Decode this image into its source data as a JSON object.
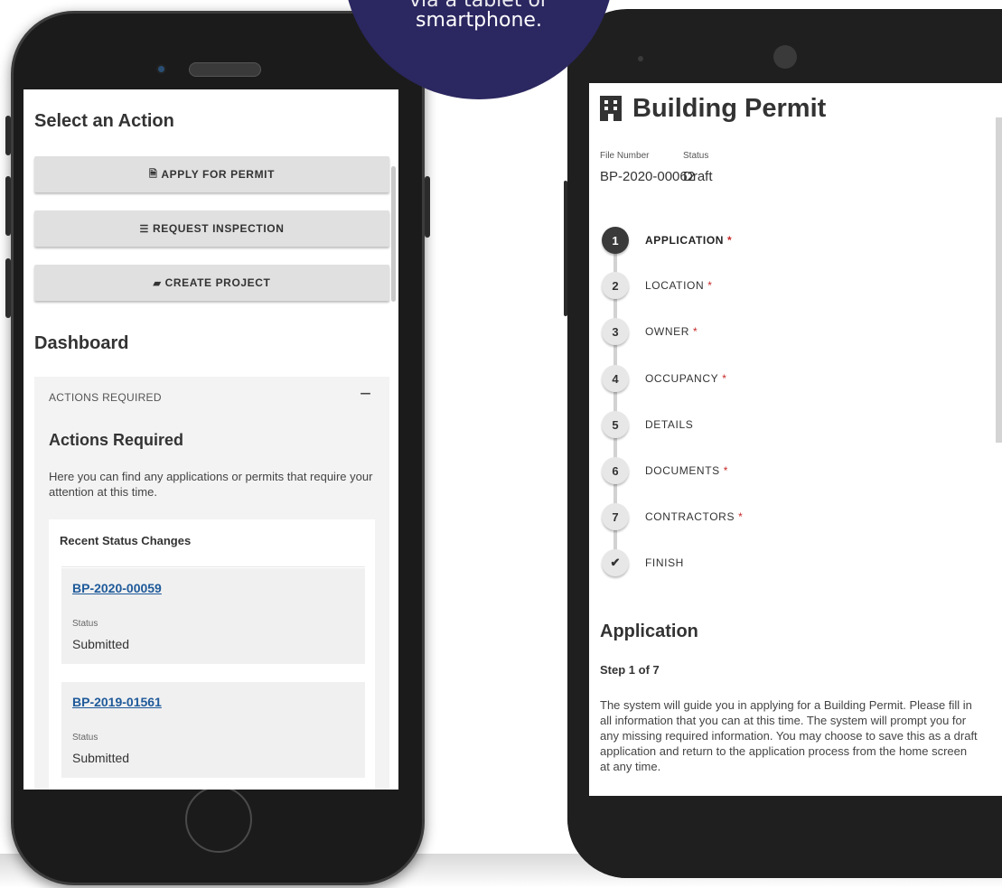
{
  "banner": {
    "line1": "via a tablet or",
    "line2": "smartphone."
  },
  "left_phone": {
    "select_action_title": "Select an Action",
    "actions": [
      {
        "icon": "document-icon",
        "glyph": "🗎",
        "label": "APPLY FOR PERMIT"
      },
      {
        "icon": "checklist-icon",
        "glyph": "☰",
        "label": "REQUEST INSPECTION"
      },
      {
        "icon": "folder-icon",
        "glyph": "▰",
        "label": "CREATE PROJECT"
      }
    ],
    "dashboard_title": "Dashboard",
    "panel": {
      "header": "ACTIONS REQUIRED",
      "collapse_glyph": "−",
      "title": "Actions Required",
      "description": "Here you can find any applications or permits that require your attention at this time.",
      "card": {
        "title": "Recent Status Changes",
        "items": [
          {
            "link": "BP-2020-00059",
            "status_label": "Status",
            "status_value": "Submitted"
          },
          {
            "link": "BP-2019-01561",
            "status_label": "Status",
            "status_value": "Submitted"
          }
        ]
      }
    }
  },
  "right_phone": {
    "title": "Building Permit",
    "file_number_label": "File Number",
    "file_number_value": "BP-2020-00062",
    "status_label": "Status",
    "status_value": "Draft",
    "steps": [
      {
        "num": "1",
        "label": "APPLICATION",
        "required": "*"
      },
      {
        "num": "2",
        "label": "LOCATION",
        "required": "*"
      },
      {
        "num": "3",
        "label": "OWNER",
        "required": "*"
      },
      {
        "num": "4",
        "label": "OCCUPANCY",
        "required": "*"
      },
      {
        "num": "5",
        "label": "DETAILS",
        "required": ""
      },
      {
        "num": "6",
        "label": "DOCUMENTS",
        "required": "*"
      },
      {
        "num": "7",
        "label": "CONTRACTORS",
        "required": "*"
      },
      {
        "num": "✔",
        "label": "FINISH",
        "required": ""
      }
    ],
    "active_step_index": 0,
    "section_title": "Application",
    "step_counter": "Step 1 of 7",
    "description": "The system will guide you in applying for a Building Permit. Please fill in all information that you can at this time. The system will prompt you for any missing required information. You may choose to save this as a draft application and return to the application process from the home screen at any time."
  }
}
